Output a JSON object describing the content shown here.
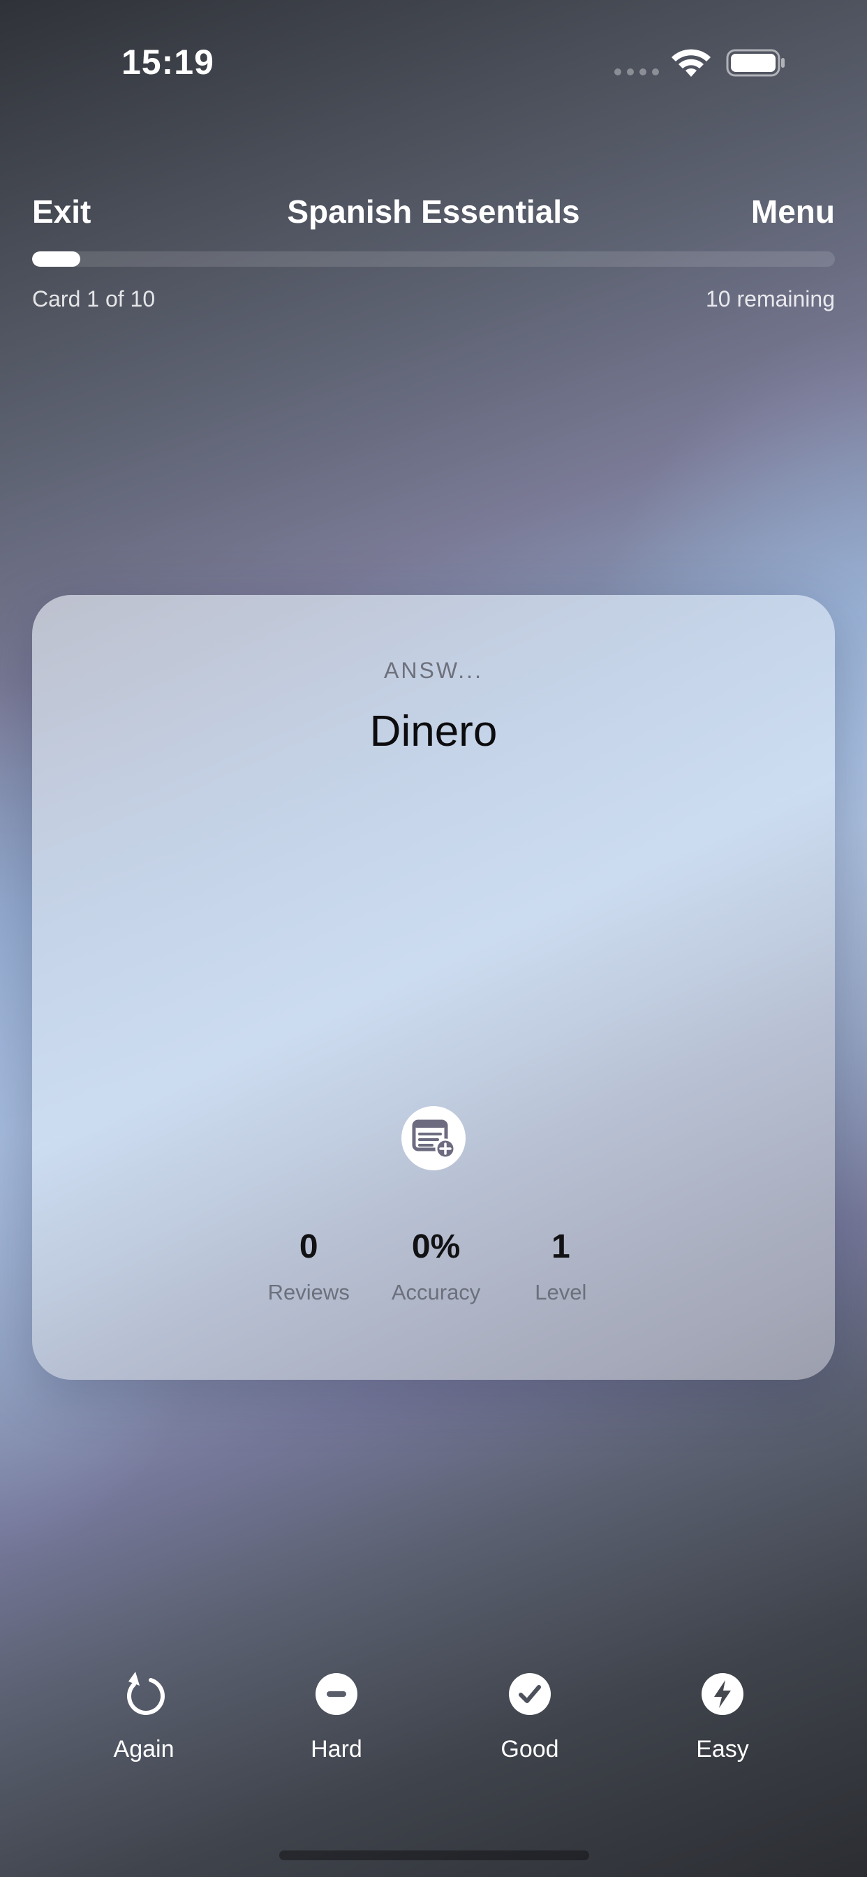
{
  "status_bar": {
    "time": "15:19"
  },
  "header": {
    "exit_label": "Exit",
    "title": "Spanish Essentials",
    "menu_label": "Menu",
    "progress_fraction": 0.06,
    "card_counter": "Card 1 of 10",
    "remaining": "10 remaining"
  },
  "card": {
    "side_label": "ANSW...",
    "word": "Dinero",
    "add_note_icon": "note-add-icon",
    "stats": [
      {
        "value": "0",
        "label": "Reviews"
      },
      {
        "value": "0%",
        "label": "Accuracy"
      },
      {
        "value": "1",
        "label": "Level"
      }
    ]
  },
  "actions": [
    {
      "label": "Again",
      "icon": "rotate-ccw-icon"
    },
    {
      "label": "Hard",
      "icon": "minus-circle-icon"
    },
    {
      "label": "Good",
      "icon": "check-circle-icon"
    },
    {
      "label": "Easy",
      "icon": "bolt-circle-icon"
    }
  ],
  "colors": {
    "card_label": "#6e717c",
    "word": "#0c0c0e",
    "stat_label": "#6c707c"
  }
}
